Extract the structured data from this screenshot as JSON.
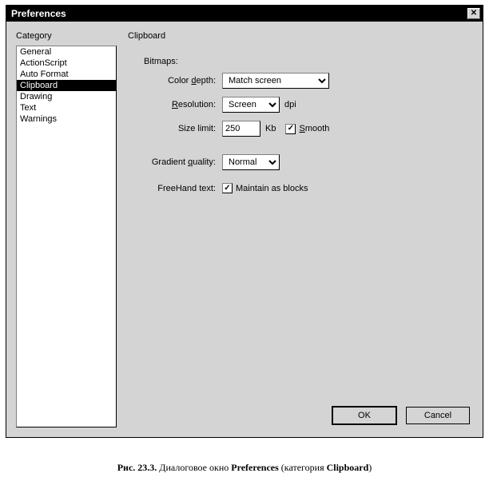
{
  "window": {
    "title": "Preferences"
  },
  "headings": {
    "category": "Category",
    "panel": "Clipboard"
  },
  "categories": [
    {
      "label": "General",
      "selected": false
    },
    {
      "label": "ActionScript",
      "selected": false
    },
    {
      "label": "Auto Format",
      "selected": false
    },
    {
      "label": "Clipboard",
      "selected": true
    },
    {
      "label": "Drawing",
      "selected": false
    },
    {
      "label": "Text",
      "selected": false
    },
    {
      "label": "Warnings",
      "selected": false
    }
  ],
  "bitmaps": {
    "group": "Bitmaps:",
    "color_depth": {
      "label_pre": "Color ",
      "u": "d",
      "label_post": "epth:",
      "value": "Match screen"
    },
    "resolution": {
      "u": "R",
      "label_post": "esolution:",
      "value": "Screen",
      "unit": "dpi"
    },
    "size_limit": {
      "label": "Size limit:",
      "value": "250",
      "unit": "Kb"
    },
    "smooth": {
      "u": "S",
      "label_post": "mooth",
      "checked": true
    }
  },
  "gradient": {
    "label_pre": "Gradient ",
    "u": "q",
    "label_post": "uality:",
    "value": "Normal"
  },
  "freehand": {
    "label": "FreeHand text:",
    "cb_label": "Maintain as blocks",
    "checked": true
  },
  "buttons": {
    "ok": "OK",
    "cancel": "Cancel"
  },
  "caption": {
    "pre": "Рис. 23.3. ",
    "mid1": "Диалоговое окно ",
    "b1": "Preferences",
    "mid2": " (категория ",
    "b2": "Clipboard",
    "post": ")"
  }
}
